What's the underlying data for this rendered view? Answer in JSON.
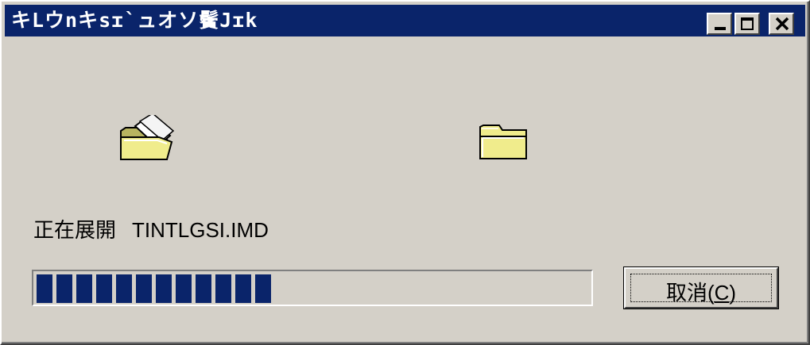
{
  "window": {
    "title": "キLウnキsɪ`ュオソ鬢Jɪk",
    "buttons": {
      "minimize": "minimize",
      "maximize": "maximize",
      "close": "close"
    }
  },
  "icons": {
    "source": "open-folder-icon",
    "destination": "closed-folder-icon"
  },
  "status": {
    "prefix": "正在展開",
    "filename": "TINTLGSI.IMD"
  },
  "progress": {
    "fraction": 0.48,
    "segments": 12
  },
  "cancel_button": {
    "label_before": "取消(",
    "accel": "C",
    "label_after": ")"
  },
  "colors": {
    "titlebar": "#0a246a",
    "face": "#d4d0c8",
    "progress": "#0a246a",
    "folder": "#f0ec8c"
  }
}
